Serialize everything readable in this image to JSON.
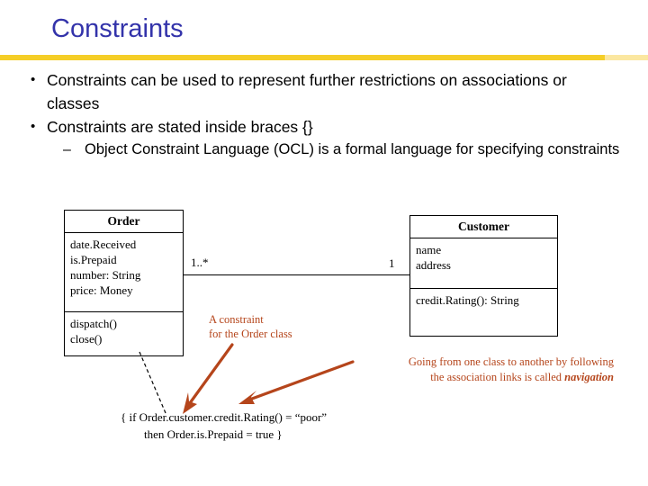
{
  "slide": {
    "title": "Constraints",
    "accent_color": "#f5ce27",
    "title_color": "#3333aa",
    "note_color": "#b5451b"
  },
  "bullets": [
    {
      "level": 1,
      "marker": "•",
      "text": "Constraints can be used to represent further restrictions on associations or classes"
    },
    {
      "level": 1,
      "marker": "•",
      "text": "Constraints are stated inside braces {}"
    },
    {
      "level": 2,
      "marker": "–",
      "text": "Object Constraint Language (OCL) is a formal language for specifying constraints"
    }
  ],
  "diagram": {
    "classes": [
      {
        "name": "Order",
        "attributes": [
          "date.Received",
          "is.Prepaid",
          "number: String",
          "price: Money"
        ],
        "operations": [
          "dispatch()",
          "close()"
        ]
      },
      {
        "name": "Customer",
        "attributes": [
          "name",
          "address"
        ],
        "operations": [
          "credit.Rating(): String"
        ]
      }
    ],
    "association": {
      "multiplicity_left": "1..*",
      "multiplicity_right": "1"
    },
    "notes": {
      "constraint_label_line1": "A constraint",
      "constraint_label_line2": "for the Order class",
      "navigation_line1": "Going from one class to another by following",
      "navigation_line2_prefix": "the association links is called ",
      "navigation_emphasis": "navigation"
    },
    "ocl": {
      "line1": "{  if  Order.customer.credit.Rating() = “poor”",
      "line2": "then  Order.is.Prepaid = true }"
    }
  }
}
